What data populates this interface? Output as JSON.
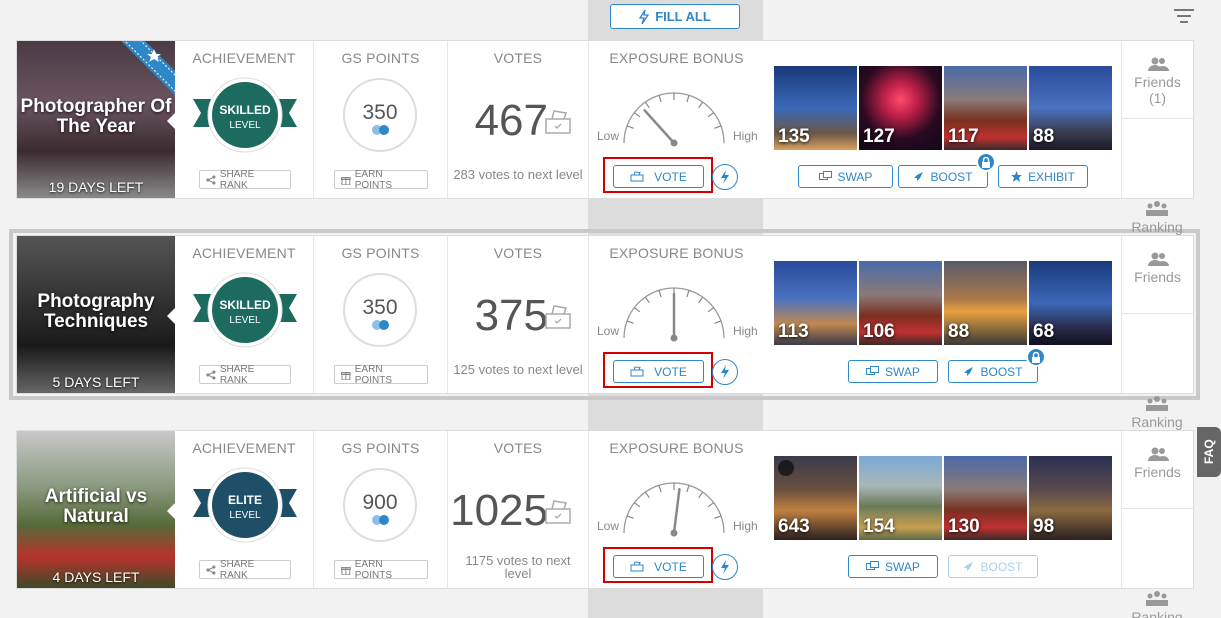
{
  "toolbar": {
    "fill_all_label": "FILL ALL",
    "filter_icon": "filter-lines-icon"
  },
  "labels": {
    "achievement": "ACHIEVEMENT",
    "gs_points": "GS POINTS",
    "votes": "VOTES",
    "exposure_bonus": "EXPOSURE BONUS",
    "share_rank": "SHARE RANK",
    "earn_points": "EARN POINTS",
    "vote": "VOTE",
    "low": "Low",
    "high": "High",
    "swap": "SWAP",
    "boost": "BOOST",
    "exhibit": "EXHIBIT",
    "friends": "Friends",
    "ranking": "Ranking",
    "faq": "FAQ"
  },
  "colors": {
    "accent": "#2e87c7",
    "highlight": "#d40000",
    "skilled": "#1d6b5f",
    "elite": "#1f4f66"
  },
  "challenges": [
    {
      "title": "Photographer Of The Year",
      "days_left": "19 DAYS LEFT",
      "achievement_level": "SKILLED\nLEVEL",
      "achievement_line1": "SKILLED",
      "achievement_line2": "LEVEL",
      "gs_points": "350",
      "votes": "467",
      "votes_next": "283 votes to next level",
      "exposure": 0.2,
      "friends_count": "(1)",
      "photos": [
        {
          "count": "135"
        },
        {
          "count": "127"
        },
        {
          "count": "117"
        },
        {
          "count": "88"
        }
      ]
    },
    {
      "title": "Photography Techniques",
      "days_left": "5 DAYS LEFT",
      "achievement_line1": "SKILLED",
      "achievement_line2": "LEVEL",
      "gs_points": "350",
      "votes": "375",
      "votes_next": "125 votes to next level",
      "exposure": 0.5,
      "photos": [
        {
          "count": "113"
        },
        {
          "count": "106"
        },
        {
          "count": "88"
        },
        {
          "count": "68"
        }
      ]
    },
    {
      "title": "Artificial vs Natural",
      "days_left": "4 DAYS LEFT",
      "achievement_line1": "ELITE",
      "achievement_line2": "LEVEL",
      "gs_points": "900",
      "votes": "1025",
      "votes_next": "1175 votes to next level",
      "exposure": 0.55,
      "photos": [
        {
          "count": "643"
        },
        {
          "count": "154"
        },
        {
          "count": "130"
        },
        {
          "count": "98"
        }
      ]
    }
  ]
}
